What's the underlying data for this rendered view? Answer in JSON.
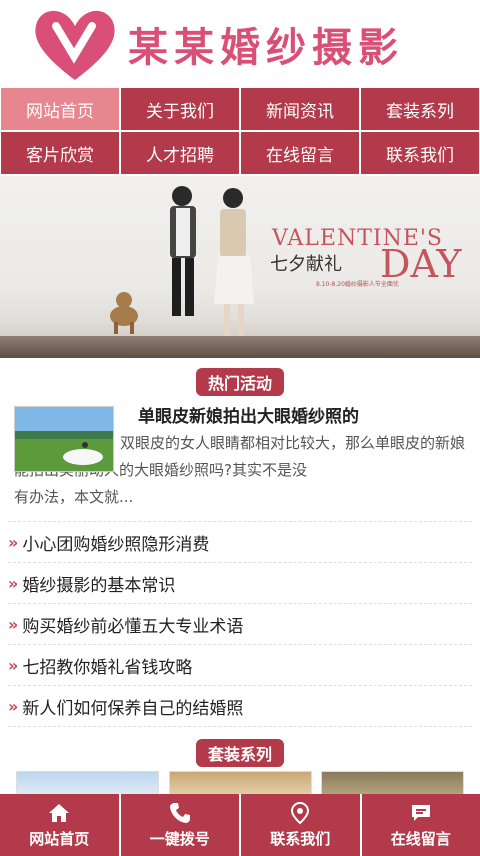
{
  "header": {
    "logo_text": "某某婚纱摄影"
  },
  "nav": [
    {
      "label": "网站首页",
      "active": true
    },
    {
      "label": "关于我们"
    },
    {
      "label": "新闻资讯"
    },
    {
      "label": "套装系列"
    },
    {
      "label": "客片欣赏"
    },
    {
      "label": "人才招聘"
    },
    {
      "label": "在线留言"
    },
    {
      "label": "联系我们"
    }
  ],
  "banner": {
    "title_line": "VALENTINE'S",
    "chinese": "七夕献礼",
    "day": "DAY",
    "small_text": "8.10-8.20婚纱摄影人节全面优"
  },
  "hot": {
    "section_label": "热门活动",
    "featured_title": "单眼皮新娘拍出大眼婚纱照的",
    "featured_desc_line1": "双眼皮的女人眼睛都相对比较大，那么单眼皮的新娘能拍出美丽动人的大眼婚纱照吗?其实不是没",
    "featured_desc_line2": "有办法，本文就..."
  },
  "articles": [
    "小心团购婚纱照隐形消费",
    "婚纱摄影的基本常识",
    "购买婚纱前必懂五大专业术语",
    "七招教你婚礼省钱攻略",
    "新人们如何保养自己的结婚照"
  ],
  "packages": {
    "section_label": "套装系列"
  },
  "bottom_bar": [
    {
      "label": "网站首页",
      "icon": "home-icon"
    },
    {
      "label": "一键拨号",
      "icon": "phone-icon"
    },
    {
      "label": "联系我们",
      "icon": "location-icon"
    },
    {
      "label": "在线留言",
      "icon": "message-icon"
    }
  ],
  "colors": {
    "primary": "#b23a4a",
    "active": "#e8868f",
    "logo": "#d94f78"
  }
}
